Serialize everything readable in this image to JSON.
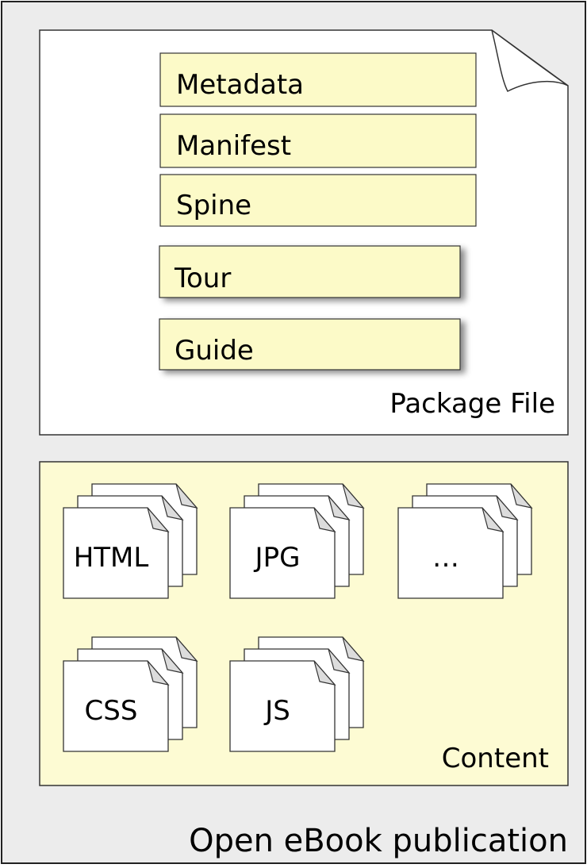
{
  "publication": {
    "label": "Open eBook publication",
    "background": "#ececec"
  },
  "package_file": {
    "label": "Package File",
    "sections": [
      {
        "label": "Metadata"
      },
      {
        "label": "Manifest"
      },
      {
        "label": "Spine"
      },
      {
        "label": "Tour"
      },
      {
        "label": "Guide"
      }
    ]
  },
  "content": {
    "label": "Content",
    "background": "#fdfbd3",
    "file_groups": [
      {
        "label": "HTML",
        "icon": "document-stack-icon"
      },
      {
        "label": "JPG",
        "icon": "document-stack-icon"
      },
      {
        "label": "…",
        "icon": "document-stack-icon"
      },
      {
        "label": "CSS",
        "icon": "document-stack-icon"
      },
      {
        "label": "JS",
        "icon": "document-stack-icon"
      }
    ]
  },
  "colors": {
    "section_fill": "#fcfac8",
    "stroke": "#333333"
  }
}
